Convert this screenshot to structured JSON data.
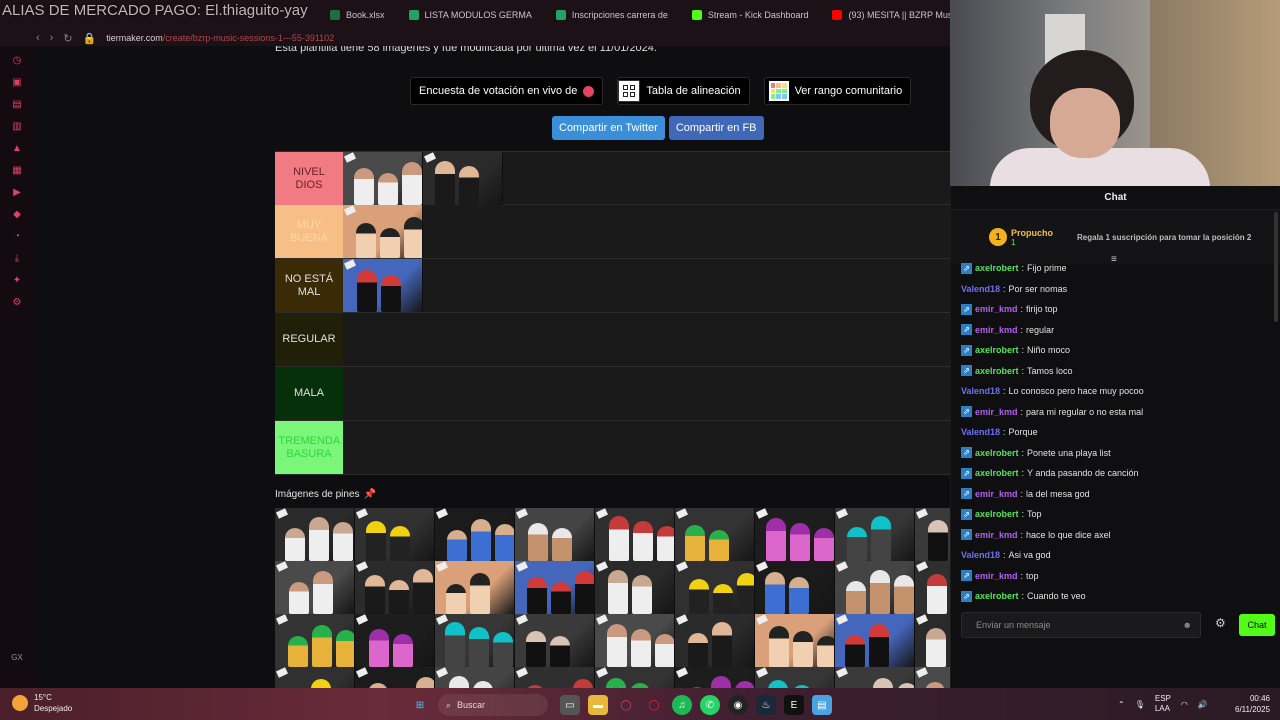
{
  "overlay_title": "ALIAS DE MERCADO PAGO: El.thiaguito-yay",
  "browser": {
    "tabs": [
      {
        "label": "Book.xlsx",
        "color": "#1d6f42"
      },
      {
        "label": "LISTA MODULOS GERMA",
        "color": "#21a366"
      },
      {
        "label": "Inscripciones carrera de",
        "color": "#21a366"
      },
      {
        "label": "Stream - Kick Dashboard",
        "color": "#53fc18"
      },
      {
        "label": "(93) MESITA || BZRP Mus",
        "color": "#ff0000"
      }
    ],
    "url_host": "tiermaker.com",
    "url_path": "/create/bzrp-music-sessions-1---55-391102"
  },
  "page": {
    "info_text": "Esta plantilla tiene 58 imágenes y fue modificada por última vez el 11/01/2024.",
    "buttons": {
      "live_poll": "Encuesta de votación en vivo de",
      "alignment": "Tabla de alineación",
      "community_rank": "Ver rango comunitario",
      "share_twitter": "Compartir en Twitter",
      "share_fb": "Compartir en FB"
    },
    "tiers": [
      {
        "label": "NIVEL DIOS",
        "color": "#f27a83",
        "count": 2
      },
      {
        "label": "MUY BUENA",
        "color": "#f7be86",
        "count": 1
      },
      {
        "label": "NO ESTÁ MAL",
        "color": "#3a2a06",
        "count": 1
      },
      {
        "label": "REGULAR",
        "color": "#202008",
        "count": 0
      },
      {
        "label": "MALA",
        "color": "#06300a",
        "count": 0
      },
      {
        "label": "TREMENDA BASURA",
        "color": "#7bf57a",
        "count": 0
      }
    ],
    "pines_title": "Imágenes de pines"
  },
  "chat": {
    "title": "Chat",
    "pinned_user": "Propucho",
    "pinned_count": "1",
    "gift_text": "Regala 1 suscripción para tomar la posición 2",
    "messages": [
      {
        "user": "axelrobert",
        "text": "Fijo prime",
        "badge": true,
        "color": "green"
      },
      {
        "user": "Valend18",
        "text": "Por ser nomas",
        "badge": false,
        "color": "purple"
      },
      {
        "user": "emir_kmd",
        "text": "firijo top",
        "badge": true,
        "color": "purple"
      },
      {
        "user": "emir_kmd",
        "text": "regular",
        "badge": true,
        "color": "purple"
      },
      {
        "user": "axelrobert",
        "text": "Niño moco",
        "badge": true,
        "color": "green"
      },
      {
        "user": "axelrobert",
        "text": "Tamos loco",
        "badge": true,
        "color": "green"
      },
      {
        "user": "Valend18",
        "text": "Lo conosco pero hace muy pocoo",
        "badge": false,
        "color": "purple"
      },
      {
        "user": "emir_kmd",
        "text": "para mi regular o no esta mal",
        "badge": true,
        "color": "purple"
      },
      {
        "user": "Valend18",
        "text": "Porque",
        "badge": false,
        "color": "purple"
      },
      {
        "user": "axelrobert",
        "text": "Ponete una playa list",
        "badge": true,
        "color": "green"
      },
      {
        "user": "axelrobert",
        "text": "Y anda pasando de canción",
        "badge": true,
        "color": "green"
      },
      {
        "user": "emir_kmd",
        "text": "la del mesa god",
        "badge": true,
        "color": "purple"
      },
      {
        "user": "axelrobert",
        "text": "Top",
        "badge": true,
        "color": "green"
      },
      {
        "user": "emir_kmd",
        "text": "hace lo que dice axel",
        "badge": true,
        "color": "purple"
      },
      {
        "user": "Valend18",
        "text": "Asi va god",
        "badge": false,
        "color": "purple"
      },
      {
        "user": "emir_kmd",
        "text": "top",
        "badge": true,
        "color": "purple"
      },
      {
        "user": "axelrobert",
        "text": "Cuando te veo",
        "badge": true,
        "color": "green"
      }
    ],
    "input_placeholder": "Enviar un mensaje",
    "send_label": "Chat"
  },
  "taskbar": {
    "temperature": "15°C",
    "weather": "Despejado",
    "search_label": "Buscar",
    "lang": "ESP",
    "lang2": "LAA",
    "time": "00:46",
    "date": "6/11/2025"
  }
}
